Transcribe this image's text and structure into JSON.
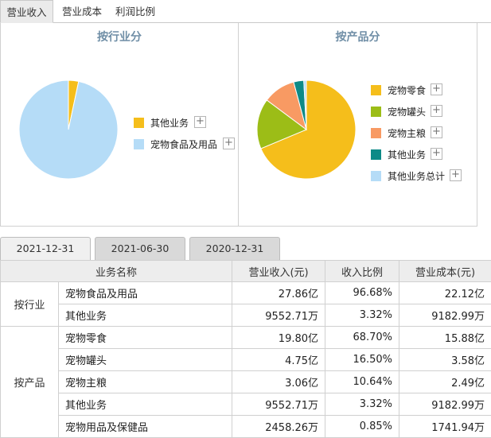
{
  "top_tabs": [
    "营业收入",
    "营业成本",
    "利润比例"
  ],
  "industry_chart": {
    "title": "按行业分",
    "legend": [
      {
        "label": "其他业务",
        "color": "#f5be1b"
      },
      {
        "label": "宠物食品及用品",
        "color": "#b5dcf7"
      }
    ]
  },
  "product_chart": {
    "title": "按产品分",
    "legend": [
      {
        "label": "宠物零食",
        "color": "#f5be1b"
      },
      {
        "label": "宠物罐头",
        "color": "#9cbd17"
      },
      {
        "label": "宠物主粮",
        "color": "#f89a63"
      },
      {
        "label": "其他业务",
        "color": "#0d8a87"
      },
      {
        "label": "其他业务总计",
        "color": "#b5dcf7"
      }
    ]
  },
  "chart_data": [
    {
      "type": "pie",
      "title": "按行业分",
      "categories": [
        "其他业务",
        "宠物食品及用品"
      ],
      "values": [
        3.32,
        96.68
      ]
    },
    {
      "type": "pie",
      "title": "按产品分",
      "categories": [
        "宠物零食",
        "宠物罐头",
        "宠物主粮",
        "其他业务",
        "其他业务总计"
      ],
      "values": [
        68.7,
        16.5,
        10.64,
        3.32,
        0.85
      ]
    }
  ],
  "date_tabs": [
    "2021-12-31",
    "2021-06-30",
    "2020-12-31"
  ],
  "table": {
    "headers": [
      "业务名称",
      "营业收入(元)",
      "收入比例",
      "营业成本(元)"
    ],
    "groups": [
      {
        "label": "按行业",
        "rows": [
          {
            "name": "宠物食品及用品",
            "revenue": "27.86亿",
            "ratio": "96.68%",
            "cost": "22.12亿"
          },
          {
            "name": "其他业务",
            "revenue": "9552.71万",
            "ratio": "3.32%",
            "cost": "9182.99万"
          }
        ]
      },
      {
        "label": "按产品",
        "rows": [
          {
            "name": "宠物零食",
            "revenue": "19.80亿",
            "ratio": "68.70%",
            "cost": "15.88亿"
          },
          {
            "name": "宠物罐头",
            "revenue": "4.75亿",
            "ratio": "16.50%",
            "cost": "3.58亿"
          },
          {
            "name": "宠物主粮",
            "revenue": "3.06亿",
            "ratio": "10.64%",
            "cost": "2.49亿"
          },
          {
            "name": "其他业务",
            "revenue": "9552.71万",
            "ratio": "3.32%",
            "cost": "9182.99万"
          },
          {
            "name": "宠物用品及保健品",
            "revenue": "2458.26万",
            "ratio": "0.85%",
            "cost": "1741.94万"
          }
        ]
      }
    ]
  }
}
